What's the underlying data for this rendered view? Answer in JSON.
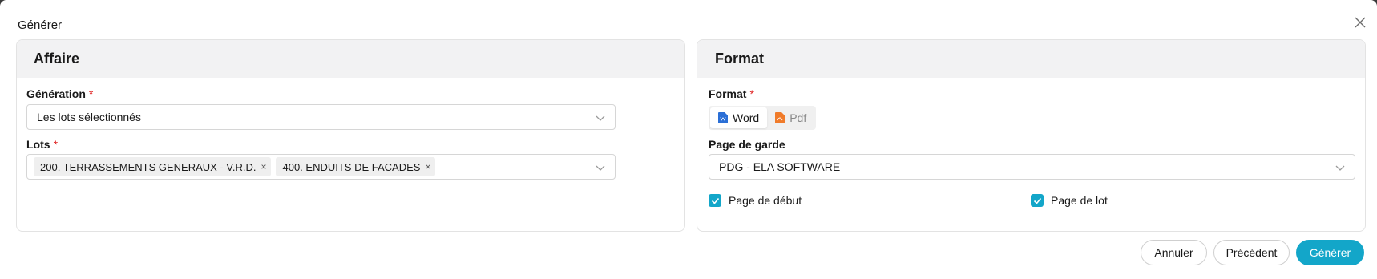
{
  "dialog": {
    "title": "Générer"
  },
  "affaire": {
    "header": "Affaire",
    "generation": {
      "label": "Génération",
      "required_mark": "*",
      "value": "Les lots sélectionnés"
    },
    "lots": {
      "label": "Lots",
      "required_mark": "*",
      "tags": [
        "200. TERRASSEMENTS GENERAUX - V.R.D.",
        "400. ENDUITS DE FACADES"
      ],
      "remove_glyph": "×"
    }
  },
  "format_panel": {
    "header": "Format",
    "format": {
      "label": "Format",
      "required_mark": "*",
      "options": [
        "Word",
        "Pdf"
      ],
      "selected": "Word"
    },
    "page_de_garde": {
      "label": "Page de garde",
      "value": "PDG - ELA SOFTWARE"
    },
    "checkboxes": [
      {
        "label": "Page de début",
        "checked": true
      },
      {
        "label": "Page de lot",
        "checked": true
      }
    ]
  },
  "footer": {
    "cancel_label": "Annuler",
    "previous_label": "Précédent",
    "generate_label": "Générer"
  },
  "colors": {
    "accent": "#13a6c9",
    "required": "#e02424",
    "word_icon": "#2b6fd6",
    "pdf_icon": "#f07b2a"
  },
  "icons": {
    "close": "close-icon",
    "chevron": "chevron-down-icon",
    "word": "word-file-icon",
    "pdf": "pdf-file-icon",
    "check": "check-icon"
  }
}
